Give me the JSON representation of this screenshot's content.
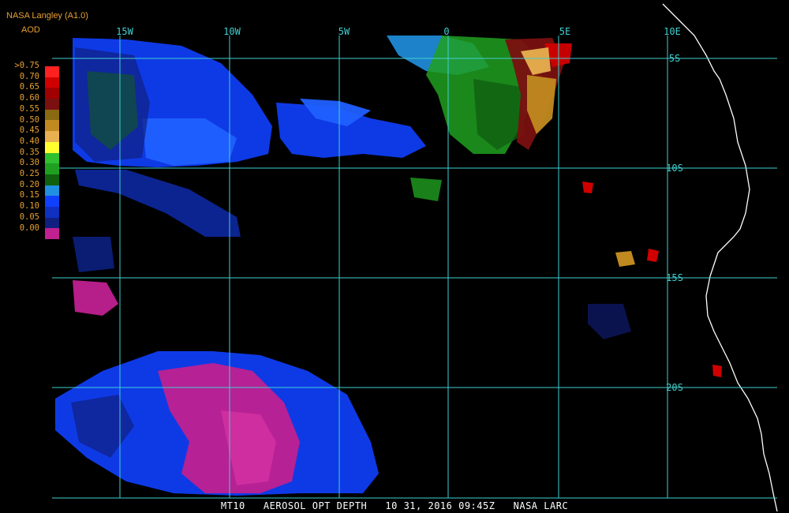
{
  "header": {
    "source": "NASA Langley (A1.0)",
    "product": "AOD"
  },
  "legend": {
    "labels": [
      ">0.75",
      "0.70",
      "0.65",
      "0.60",
      "0.55",
      "0.50",
      "0.45",
      "0.40",
      "0.35",
      "0.30",
      "0.25",
      "0.20",
      "0.15",
      "0.10",
      "0.05",
      "0.00"
    ],
    "colors": [
      "#ff2020",
      "#d00000",
      "#a00000",
      "#7a1010",
      "#8a6a10",
      "#c08a20",
      "#e8b050",
      "#ffff30",
      "#30c030",
      "#20a020",
      "#106010",
      "#2090e0",
      "#1040ff",
      "#1030c0",
      "#102080",
      "#c02090"
    ]
  },
  "grid": {
    "longitude_labels": [
      "15W",
      "10W",
      "5W",
      "0",
      "5E",
      "10E"
    ],
    "latitude_labels": [
      "5S",
      "10S",
      "15S",
      "20S"
    ],
    "line_color": "#40d0d0"
  },
  "footer": {
    "text": "MT10   AEROSOL OPT DEPTH   10 31, 2016 09:45Z   NASA LARC"
  }
}
